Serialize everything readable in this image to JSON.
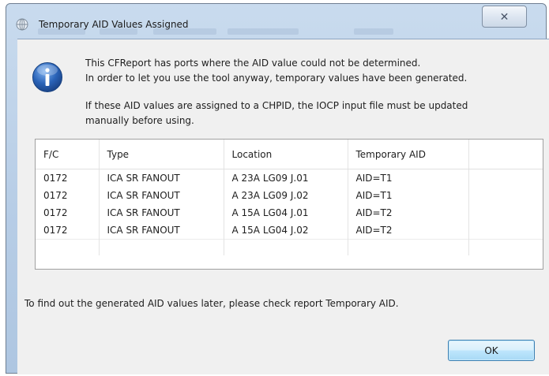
{
  "window": {
    "title": "Temporary AID Values Assigned",
    "close_glyph": "✕",
    "icon": "app-globe-icon"
  },
  "message": {
    "icon": "info-icon",
    "line1": "This CFReport has ports where the AID value could not be determined.",
    "line2": "In order to let you use the tool anyway, temporary values have been generated.",
    "line3": "If these AID values are assigned to a CHPID, the IOCP input file must be updated",
    "line4": "manually before using."
  },
  "table": {
    "columns": [
      "F/C",
      "Type",
      "Location",
      "Temporary AID",
      ""
    ],
    "rows": [
      [
        "0172",
        "ICA SR FANOUT",
        "A 23A LG09 J.01",
        "AID=T1",
        ""
      ],
      [
        "0172",
        "ICA SR FANOUT",
        "A 23A LG09 J.02",
        "AID=T1",
        ""
      ],
      [
        "0172",
        "ICA SR FANOUT",
        "A 15A LG04 J.01",
        "AID=T2",
        ""
      ],
      [
        "0172",
        "ICA SR FANOUT",
        "A 15A LG04 J.02",
        "AID=T2",
        ""
      ]
    ]
  },
  "footer": {
    "note": "To find out the generated AID values later, please check report Temporary AID.",
    "ok_label": "OK"
  },
  "colors": {
    "title_bar": "#b7cde6",
    "client_bg": "#f0f0f0",
    "ok_button_border": "#3c7fb1",
    "info_icon": "#2a63b8"
  }
}
